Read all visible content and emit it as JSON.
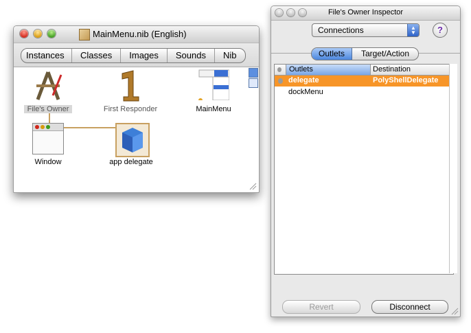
{
  "nib_window": {
    "title": "MainMenu.nib (English)",
    "tabs": [
      "Instances",
      "Classes",
      "Images",
      "Sounds",
      "Nib"
    ],
    "items": {
      "files_owner": "File's Owner",
      "first_responder": "First Responder",
      "main_menu": "MainMenu",
      "window": "Window",
      "app_delegate": "app delegate"
    }
  },
  "inspector": {
    "title": "File's Owner Inspector",
    "popup_value": "Connections",
    "help_label": "?",
    "tabs": [
      "Outlets",
      "Target/Action"
    ],
    "columns": [
      "Outlets",
      "Destination"
    ],
    "rows": [
      {
        "outlet": "delegate",
        "destination": "PolyShellDelegate"
      },
      {
        "outlet": "dockMenu",
        "destination": ""
      }
    ],
    "revert_label": "Revert",
    "disconnect_label": "Disconnect"
  },
  "colors": {
    "selection_orange": "#f79528",
    "connection_line": "#c8a060",
    "selected_tab_blue": "#4b86de"
  }
}
